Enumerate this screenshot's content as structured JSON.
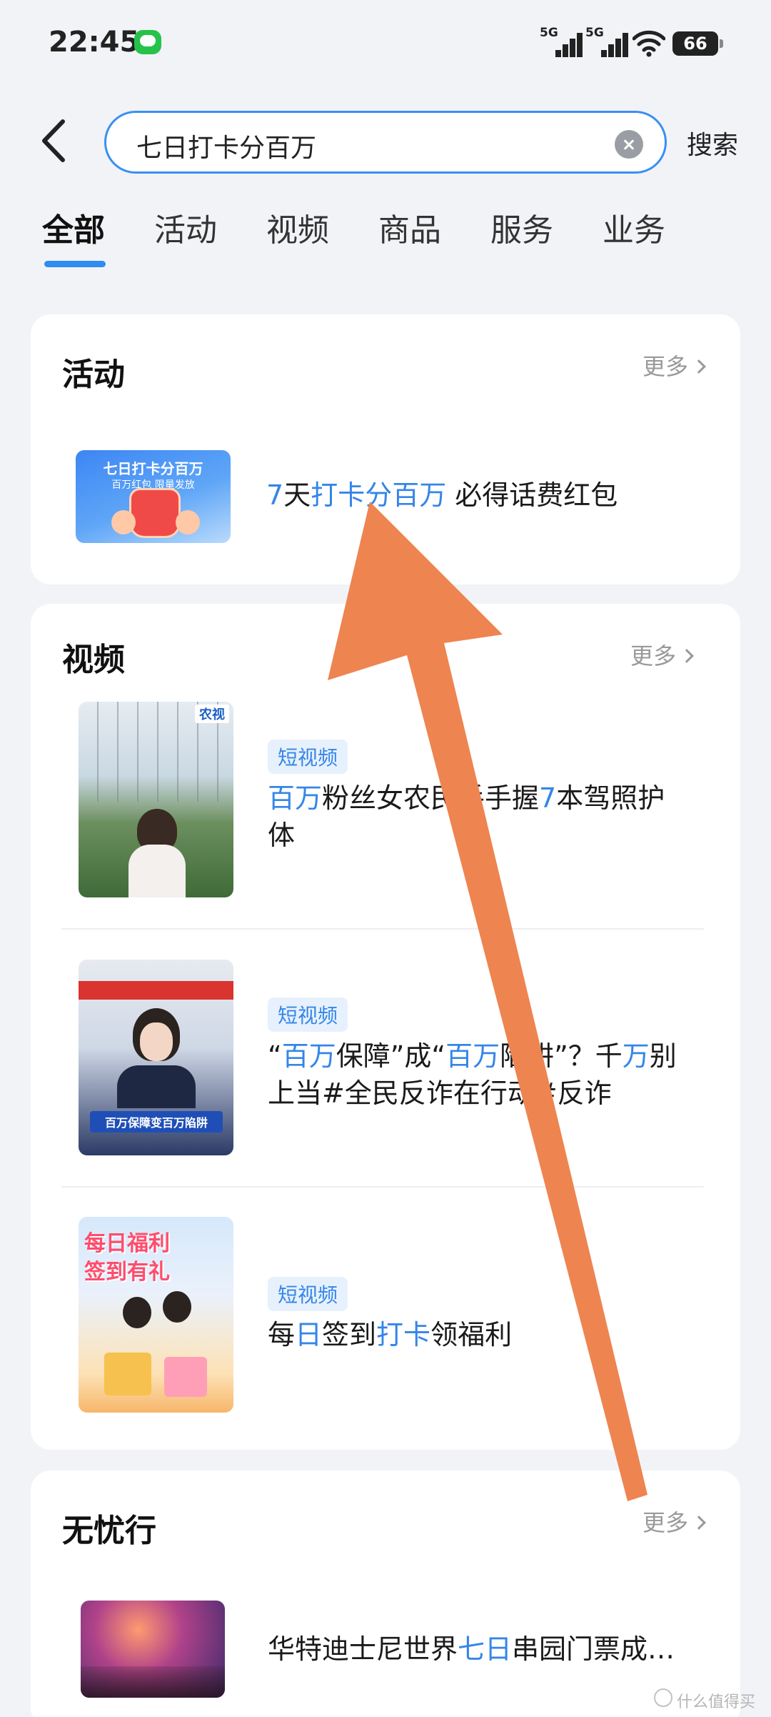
{
  "status_bar": {
    "time": "22:45",
    "network_1": "5G",
    "network_2": "5G",
    "battery": "66"
  },
  "search": {
    "query": "七日打卡分百万",
    "button_label": "搜索"
  },
  "tabs": [
    {
      "label": "全部",
      "active": true
    },
    {
      "label": "活动",
      "active": false
    },
    {
      "label": "视频",
      "active": false
    },
    {
      "label": "商品",
      "active": false
    },
    {
      "label": "服务",
      "active": false
    },
    {
      "label": "业务",
      "active": false
    }
  ],
  "activity_section": {
    "title": "活动",
    "more": "更多",
    "item": {
      "thumb_title": "七日打卡分百万",
      "thumb_subtitle": "百万红包 限量发放",
      "title_parts": [
        {
          "t": "7",
          "hl": true
        },
        {
          "t": "天",
          "hl": false
        },
        {
          "t": "打卡分百万",
          "hl": true
        },
        {
          "t": " 必得话费红包",
          "hl": false
        }
      ]
    }
  },
  "video_section": {
    "title": "视频",
    "more": "更多",
    "badge": "短视频",
    "items": [
      {
        "thumb_text": "农视",
        "line1": [
          {
            "t": "百万",
            "hl": true
          },
          {
            "t": "粉丝女农民手手握",
            "hl": false
          },
          {
            "t": "7",
            "hl": true
          },
          {
            "t": "本驾照护",
            "hl": false
          }
        ],
        "line2": [
          {
            "t": "体",
            "hl": false
          }
        ]
      },
      {
        "thumb_text": "百万保障变百万陷阱",
        "line1": [
          {
            "t": "“",
            "hl": false
          },
          {
            "t": "百万",
            "hl": true
          },
          {
            "t": "保障”成“",
            "hl": false
          },
          {
            "t": "百万",
            "hl": true
          },
          {
            "t": "陷阱”？千",
            "hl": false
          },
          {
            "t": "万",
            "hl": true
          },
          {
            "t": "别",
            "hl": false
          }
        ],
        "line2": [
          {
            "t": "上当#全民反诈在行动#反诈",
            "hl": false
          }
        ]
      },
      {
        "thumb_text": "每日福利 签到有礼",
        "line1": [
          {
            "t": "每",
            "hl": false
          },
          {
            "t": "日",
            "hl": true
          },
          {
            "t": "签到",
            "hl": false
          },
          {
            "t": "打卡",
            "hl": true
          },
          {
            "t": "领福利",
            "hl": false
          }
        ],
        "line2": []
      }
    ]
  },
  "travel_section": {
    "title": "无忧行",
    "more": "更多",
    "item": {
      "title_parts": [
        {
          "t": "华特迪士尼世界",
          "hl": false
        },
        {
          "t": "七日",
          "hl": true
        },
        {
          "t": "串园门票成…",
          "hl": false
        }
      ]
    }
  },
  "watermark": "什么值得买",
  "colors": {
    "accent": "#3486e8",
    "arrow": "#ee8450",
    "background": "#f2f3f7"
  }
}
